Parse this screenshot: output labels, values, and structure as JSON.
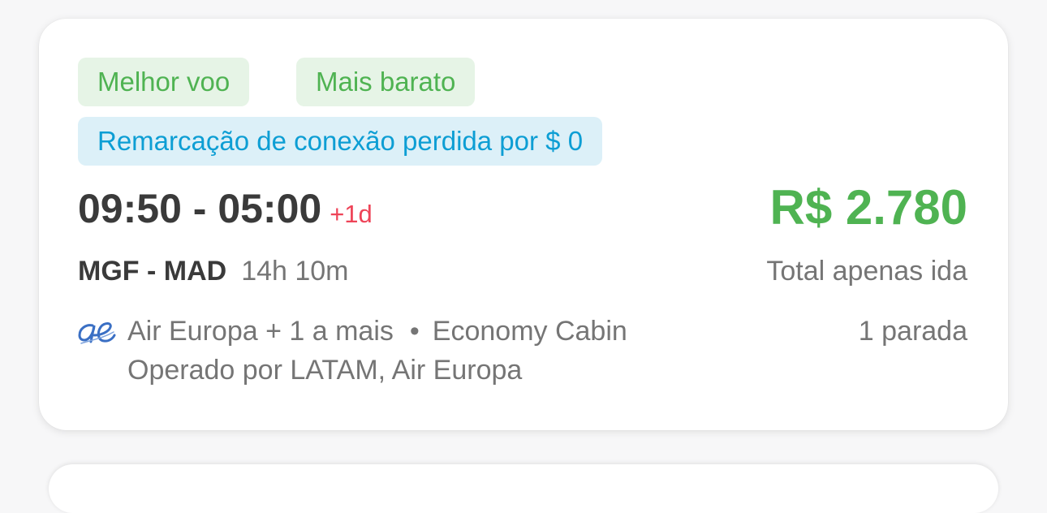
{
  "card": {
    "tags": {
      "best": "Melhor voo",
      "cheapest": "Mais barato",
      "rebooking": "Remarcação de conexão perdida por $ 0"
    },
    "times": "09:50 - 05:00",
    "day_offset": "+1d",
    "price": "R$ 2.780",
    "route": "MGF - MAD",
    "duration": "14h 10m",
    "price_note": "Total apenas ida",
    "airline_logo_icon": "air-europa-logo-icon",
    "airline": "Air Europa + 1 a mais",
    "separator": "•",
    "cabin": "Economy Cabin",
    "operated_by": "Operado por LATAM, Air Europa",
    "stops": "1 parada"
  },
  "colors": {
    "green_accent": "#4fb352",
    "green_tag_bg": "#e6f4e6",
    "blue_accent": "#0d9ed4",
    "blue_tag_bg": "#dcf0f8",
    "day_offset_red": "#ee4458",
    "airline_logo_blue": "#3a6fc4"
  }
}
